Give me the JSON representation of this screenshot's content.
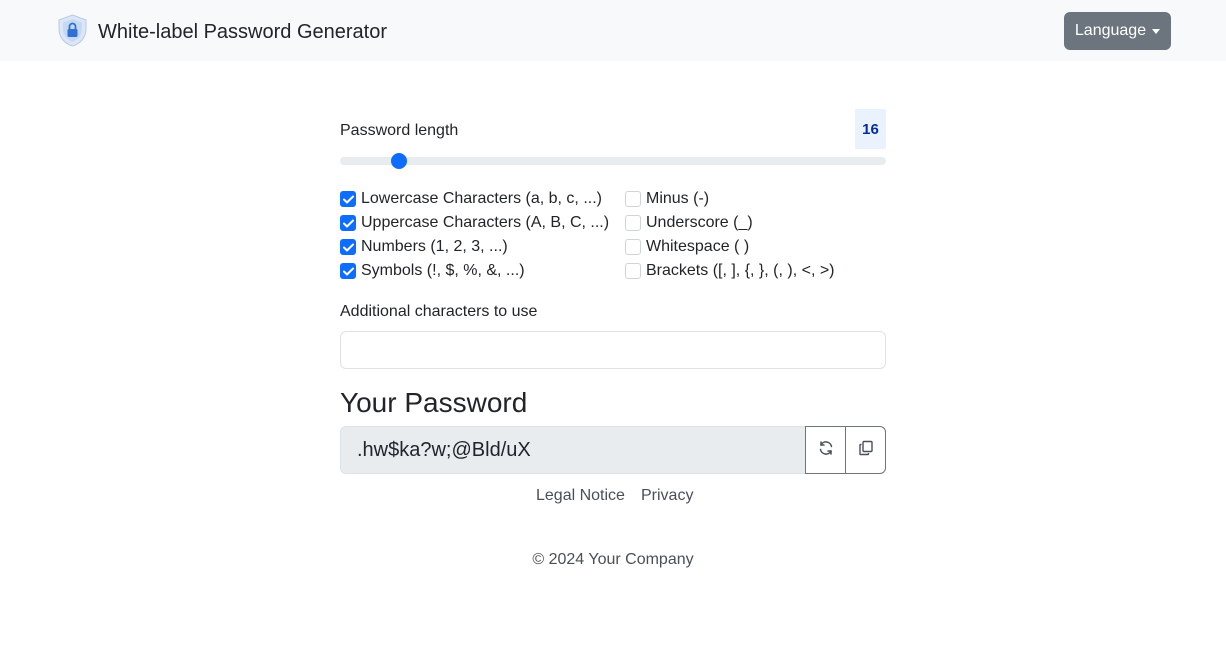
{
  "header": {
    "title": "White-label Password Generator",
    "logo_icon": "shield-lock-icon",
    "language_button": "Language"
  },
  "length": {
    "label": "Password length",
    "value": "16",
    "min": 4,
    "max": 128
  },
  "options": {
    "left": [
      {
        "label": "Lowercase Characters (a, b, c, ...)",
        "checked": true
      },
      {
        "label": "Uppercase Characters (A, B, C, ...)",
        "checked": true
      },
      {
        "label": "Numbers (1, 2, 3, ...)",
        "checked": true
      },
      {
        "label": "Symbols (!, $, %, &, ...)",
        "checked": true
      }
    ],
    "right": [
      {
        "label": "Minus (-)",
        "checked": false
      },
      {
        "label": "Underscore (_)",
        "checked": false
      },
      {
        "label": "Whitespace ( )",
        "checked": false
      },
      {
        "label": "Brackets ([, ], {, }, (, ), <, >)",
        "checked": false
      }
    ]
  },
  "additional": {
    "label": "Additional characters to use",
    "value": "",
    "placeholder": ""
  },
  "result": {
    "heading": "Your Password",
    "password": ".hw$ka?w;@Bld/uX",
    "refresh_icon": "refresh-icon",
    "copy_icon": "copy-icon"
  },
  "footer": {
    "links": [
      "Legal Notice",
      "Privacy"
    ],
    "copyright": "© 2024 Your Company"
  },
  "colors": {
    "accent": "#0d6efd",
    "navbar_bg": "#f8f9fa",
    "secondary": "#6c757d"
  }
}
